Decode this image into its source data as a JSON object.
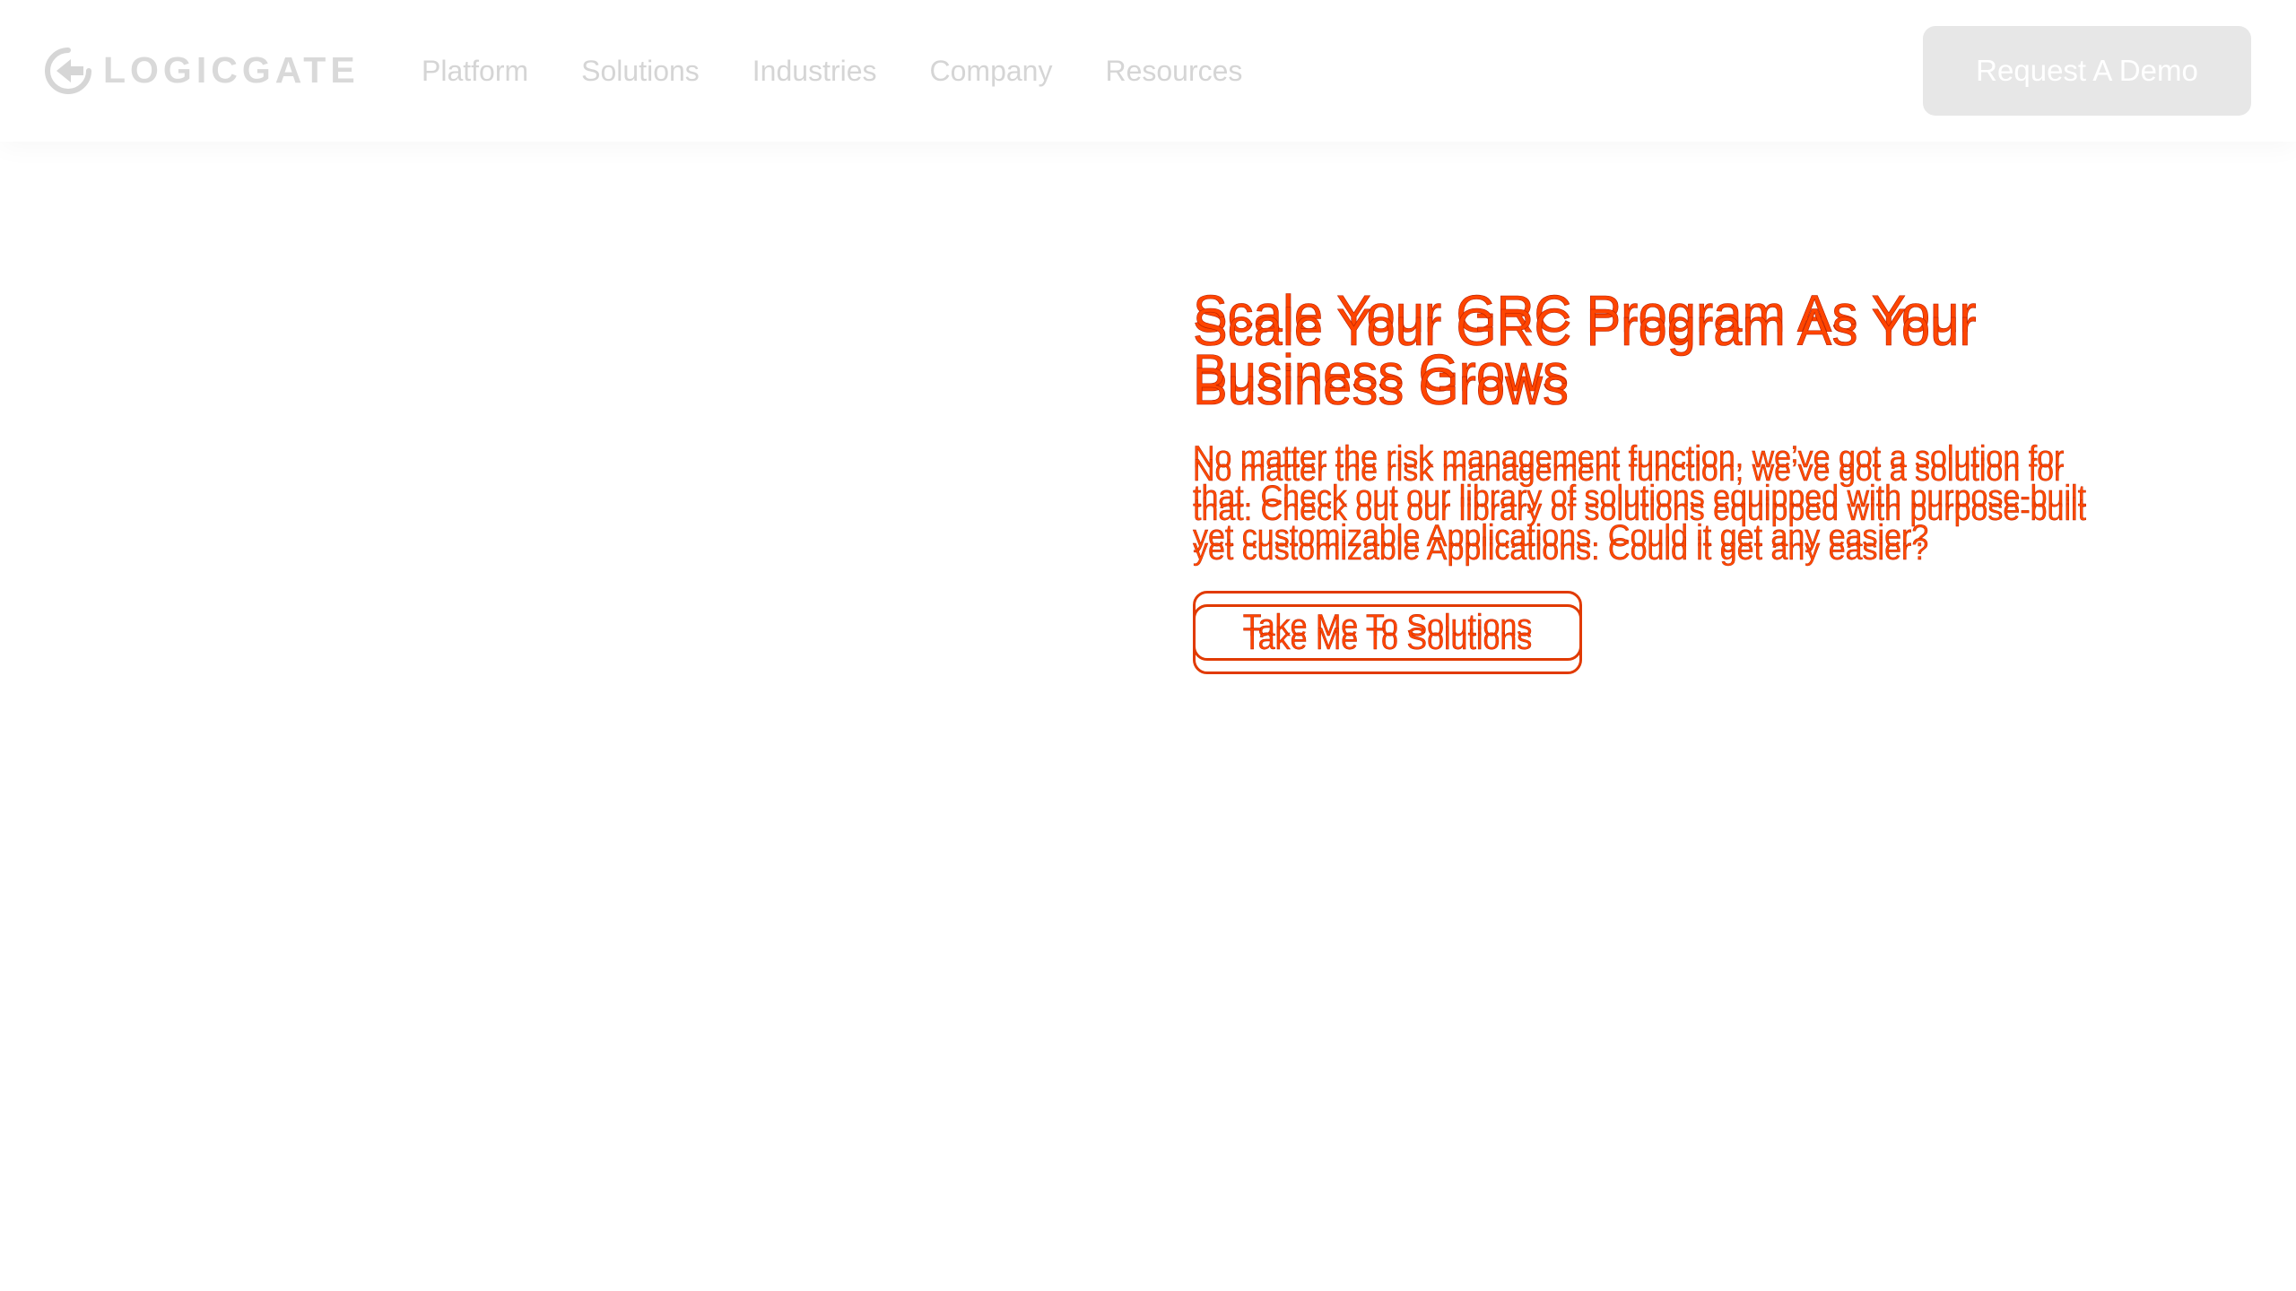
{
  "brand": {
    "name": "LOGICGATE",
    "logo_icon": "logicgate-logo-icon"
  },
  "nav": {
    "items": [
      {
        "label": "Platform"
      },
      {
        "label": "Solutions"
      },
      {
        "label": "Industries"
      },
      {
        "label": "Company"
      },
      {
        "label": "Resources"
      }
    ],
    "cta_label": "Request A Demo"
  },
  "hero": {
    "title": "Scale Your GRC Program As Your Business Grows",
    "description": "No matter the risk management function, we’ve got a solution for that. Check out our library of solutions equipped with purpose-built yet customizable Applications. Could it get any easier?",
    "button_label": "Take Me To Solutions"
  },
  "colors": {
    "nav_text": "#d5d5d5",
    "cta_bg": "#e7e7e7",
    "hero_text": "#ff4500",
    "hero_outline": "#e13a00"
  }
}
